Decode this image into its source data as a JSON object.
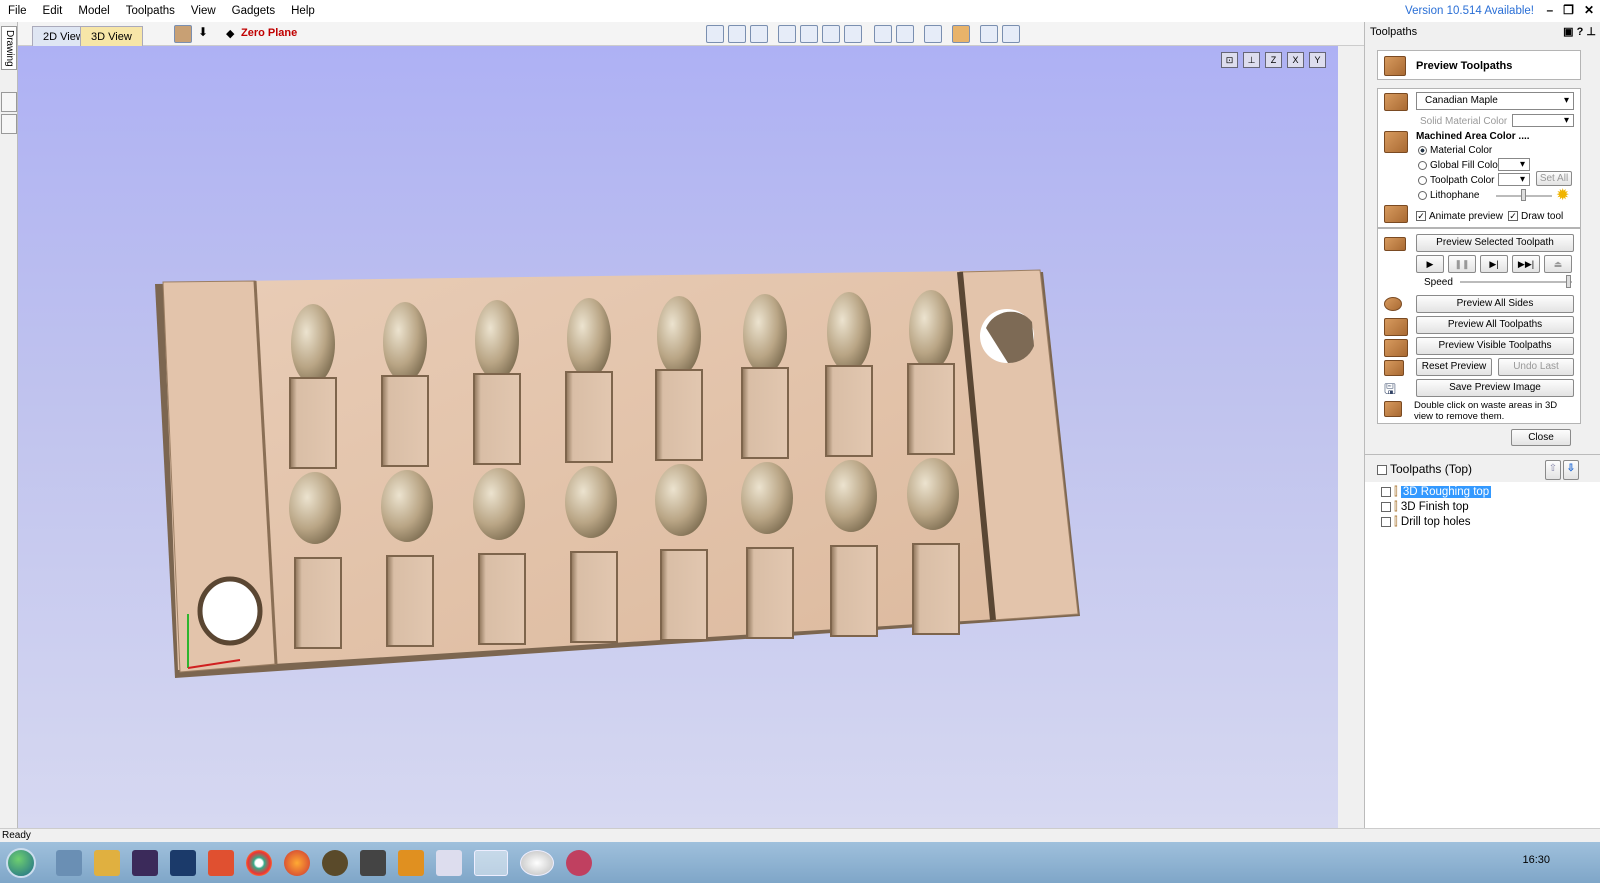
{
  "menu": [
    "File",
    "Edit",
    "Model",
    "Toolpaths",
    "View",
    "Gadgets",
    "Help"
  ],
  "version_text": "Version 10.514 Available!",
  "tabs": {
    "view2d": "2D View",
    "view3d": "3D View"
  },
  "zero_plane": "Zero Plane",
  "side_tab": "Drawing",
  "status": "Ready",
  "clock": "16:30",
  "panel": {
    "header": "Toolpaths",
    "title": "Preview Toolpaths",
    "material": "Canadian Maple",
    "solid_material_color": "Solid Material Color",
    "machined_area_color": "Machined Area Color ....",
    "radios": [
      "Material Color",
      "Global Fill Color",
      "Toolpath Color",
      "Lithophane"
    ],
    "set_all": "Set All",
    "animate_preview": "Animate preview",
    "draw_tool": "Draw tool",
    "preview_selected": "Preview Selected Toolpath",
    "speed": "Speed",
    "preview_all_sides": "Preview All Sides",
    "preview_all_toolpaths": "Preview All Toolpaths",
    "preview_visible_toolpaths": "Preview Visible Toolpaths",
    "reset_preview": "Reset Preview",
    "undo_last": "Undo Last",
    "save_preview_image": "Save Preview Image",
    "hint": "Double click on waste areas in 3D view to remove them.",
    "close": "Close",
    "list_title": "Toolpaths (Top)",
    "toolpaths": [
      "3D Roughing top",
      "3D Finish top",
      "Drill top holes"
    ]
  }
}
